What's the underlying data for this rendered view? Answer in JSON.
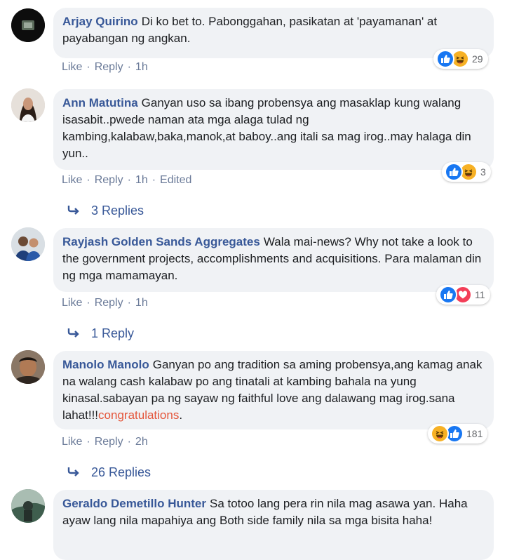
{
  "comments": [
    {
      "author": "Arjay Quirino",
      "text": "Di ko bet to. Pabonggahan, pasikatan at 'payamanan' at payabangan ng angkan.",
      "actions": {
        "like": "Like",
        "reply": "Reply",
        "time": "1h"
      },
      "reactions": {
        "icons": [
          "like",
          "haha"
        ],
        "count": "29"
      }
    },
    {
      "author": "Ann Matutina",
      "text": "Ganyan uso sa ibang probensya ang masaklap kung walang isasabit..pwede naman ata mga alaga tulad ng kambing,kalabaw,baka,manok,at baboy..ang itali sa mag irog..may halaga din yun..",
      "actions": {
        "like": "Like",
        "reply": "Reply",
        "time": "1h",
        "edited": "Edited"
      },
      "reactions": {
        "icons": [
          "like",
          "haha"
        ],
        "count": "3"
      },
      "replies": "3 Replies"
    },
    {
      "author": "Rayjash Golden Sands Aggregates",
      "text": "Wala mai-news? Why not take a look to the government projects, accomplishments and acquisitions. Para malaman din ng mga mamamayan.",
      "actions": {
        "like": "Like",
        "reply": "Reply",
        "time": "1h"
      },
      "reactions": {
        "icons": [
          "like",
          "love"
        ],
        "count": "11"
      },
      "replies": "1 Reply"
    },
    {
      "author": "Manolo Manolo",
      "text": "Ganyan po ang tradition sa aming probensya,ang kamag anak na walang cash kalabaw po ang tinatali at kambing bahala na yung kinasal.sabayan pa ng sayaw ng faithful love ang dalawang mag irog.sana lahat!!!",
      "highlight": "congratulations",
      "text_end": ".",
      "actions": {
        "like": "Like",
        "reply": "Reply",
        "time": "2h"
      },
      "reactions": {
        "icons": [
          "haha",
          "like"
        ],
        "count": "181"
      },
      "replies": "26 Replies"
    },
    {
      "author": "Geraldo Demetillo Hunter",
      "text": "Sa totoo lang pera rin nila mag asawa yan. Haha ayaw lang nila mapahiya ang Both side family nila sa mga bisita haha!"
    }
  ],
  "colors": {
    "author": "#385898",
    "bubble": "#f0f2f5",
    "like_blue": "#1877f2",
    "haha_yellow": "#f7b125",
    "love_red": "#f33e58"
  },
  "icons": {
    "like": "thumbs-up-icon",
    "haha": "laughing-face-icon",
    "love": "heart-icon",
    "reply_arrow": "reply-arrow-icon"
  }
}
